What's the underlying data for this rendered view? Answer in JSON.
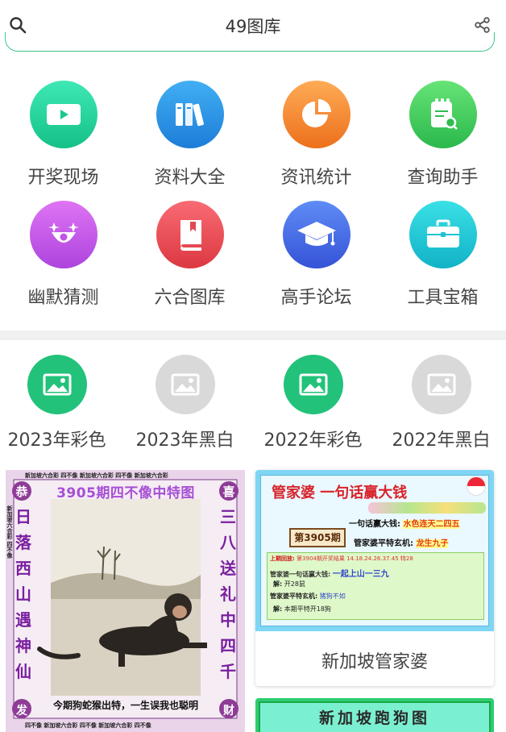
{
  "header": {
    "title": "49图库"
  },
  "menu": [
    {
      "label": "开奖现场",
      "icon": "video-camera-icon",
      "color_from": "#2ee6b0",
      "color_to": "#16c48a"
    },
    {
      "label": "资料大全",
      "icon": "books-icon",
      "color_from": "#3aa9f2",
      "color_to": "#1f7fd9"
    },
    {
      "label": "资讯统计",
      "icon": "pie-chart-icon",
      "color_from": "#ffa24a",
      "color_to": "#ef7420"
    },
    {
      "label": "查询助手",
      "icon": "document-search-icon",
      "color_from": "#60e070",
      "color_to": "#2cb94e"
    },
    {
      "label": "幽默猜测",
      "icon": "clown-face-icon",
      "color_from": "#d86bf0",
      "color_to": "#b048e0"
    },
    {
      "label": "六合图库",
      "icon": "book-icon",
      "color_from": "#f7646c",
      "color_to": "#de3b45"
    },
    {
      "label": "高手论坛",
      "icon": "graduation-cap-icon",
      "color_from": "#5a86f5",
      "color_to": "#3757d8"
    },
    {
      "label": "工具宝箱",
      "icon": "toolbox-icon",
      "color_from": "#34dbe2",
      "color_to": "#13b4c8"
    }
  ],
  "years": [
    {
      "label": "2023年彩色",
      "color": "#22c27a"
    },
    {
      "label": "2023年黑白",
      "color": "#d8d8d8"
    },
    {
      "label": "2022年彩色",
      "color": "#22c27a"
    },
    {
      "label": "2022年黑白",
      "color": "#d8d8d8"
    }
  ],
  "card_left": {
    "banner": "3905期四不像中特图",
    "corner_left": "恭",
    "corner_right": "喜",
    "left_column": "日落西山遇神仙",
    "right_column": "三八送礼中四千",
    "bottom_text": "今期狗蛇猴出特，一生误我也聪明",
    "bottom_left": "发",
    "bottom_right": "财",
    "border_top": "新加坡六合彩 四不像 新加坡六合彩 四不像 新加坡六合彩",
    "border_bottom": "四不像 新加坡六合彩 四不像 新加坡六合彩 四不像",
    "border_side": "新加坡六合彩 四不像"
  },
  "card_right": {
    "title": "管家婆  一句话赢大钱",
    "issue": "第3905期",
    "line1_label": "一句话赢大钱:",
    "line1_value": "水色连天二四五",
    "line2_label": "管家婆平特玄机:",
    "line2_value": "龙生九子",
    "history_label": "上期回放:",
    "history_value": "第3904期开奖结果   14.18.24.26.37.45  特28",
    "row1_label": "管家婆一句话赢大钱:",
    "row1_value": "一起上山一三九",
    "row2_label": "解:",
    "row2_value": "开28鼠",
    "row3_label": "管家婆平特玄机:",
    "row3_value": "猪狗不如",
    "row4_label": "解:",
    "row4_value": "本期平特开18狗",
    "caption": "新加坡管家婆"
  },
  "card_right2": {
    "title": "新加坡跑狗图"
  }
}
